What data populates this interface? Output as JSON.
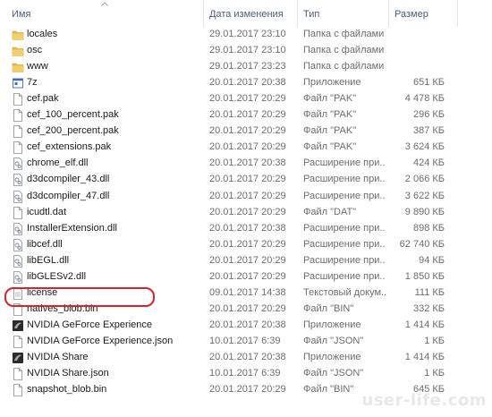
{
  "columns": {
    "name": "Имя",
    "date": "Дата изменения",
    "type": "Тип",
    "size": "Размер"
  },
  "files": [
    {
      "name": "locales",
      "date": "29.01.2017 23:10",
      "type": "Папка с файлами",
      "size": "",
      "icon": "folder-icon"
    },
    {
      "name": "osc",
      "date": "29.01.2017 23:10",
      "type": "Папка с файлами",
      "size": "",
      "icon": "folder-icon"
    },
    {
      "name": "www",
      "date": "29.01.2017 23:23",
      "type": "Папка с файлами",
      "size": "",
      "icon": "folder-icon"
    },
    {
      "name": "7z",
      "date": "20.01.2017 20:38",
      "type": "Приложение",
      "size": "651 КБ",
      "icon": "app-icon"
    },
    {
      "name": "cef.pak",
      "date": "20.01.2017 20:29",
      "type": "Файл \"PAK\"",
      "size": "4 478 КБ",
      "icon": "file-icon"
    },
    {
      "name": "cef_100_percent.pak",
      "date": "20.01.2017 20:29",
      "type": "Файл \"PAK\"",
      "size": "296 КБ",
      "icon": "file-icon"
    },
    {
      "name": "cef_200_percent.pak",
      "date": "20.01.2017 20:29",
      "type": "Файл \"PAK\"",
      "size": "387 КБ",
      "icon": "file-icon"
    },
    {
      "name": "cef_extensions.pak",
      "date": "20.01.2017 20:29",
      "type": "Файл \"PAK\"",
      "size": "3 624 КБ",
      "icon": "file-icon"
    },
    {
      "name": "chrome_elf.dll",
      "date": "20.01.2017 20:38",
      "type": "Расширение при...",
      "size": "424 КБ",
      "icon": "dll-icon"
    },
    {
      "name": "d3dcompiler_43.dll",
      "date": "20.01.2017 20:29",
      "type": "Расширение при...",
      "size": "2 066 КБ",
      "icon": "dll-icon"
    },
    {
      "name": "d3dcompiler_47.dll",
      "date": "20.01.2017 20:29",
      "type": "Расширение при...",
      "size": "3 622 КБ",
      "icon": "dll-icon"
    },
    {
      "name": "icudtl.dat",
      "date": "20.01.2017 20:29",
      "type": "Файл \"DAT\"",
      "size": "9 890 КБ",
      "icon": "file-icon"
    },
    {
      "name": "InstallerExtension.dll",
      "date": "20.01.2017 20:38",
      "type": "Расширение при...",
      "size": "898 КБ",
      "icon": "dll-icon"
    },
    {
      "name": "libcef.dll",
      "date": "20.01.2017 20:29",
      "type": "Расширение при...",
      "size": "62 740 КБ",
      "icon": "dll-icon"
    },
    {
      "name": "libEGL.dll",
      "date": "20.01.2017 20:29",
      "type": "Расширение при...",
      "size": "94 КБ",
      "icon": "dll-icon"
    },
    {
      "name": "libGLESv2.dll",
      "date": "20.01.2017 20:29",
      "type": "Расширение при...",
      "size": "1 850 КБ",
      "icon": "dll-icon"
    },
    {
      "name": "license",
      "date": "09.01.2017 14:38",
      "type": "Текстовый докум...",
      "size": "111 КБ",
      "icon": "text-file-icon"
    },
    {
      "name": "natives_blob.bin",
      "date": "20.01.2017 20:29",
      "type": "Файл \"BIN\"",
      "size": "332 КБ",
      "icon": "file-icon"
    },
    {
      "name": "NVIDIA GeForce Experience",
      "date": "20.01.2017 20:38",
      "type": "Приложение",
      "size": "1 414 КБ",
      "icon": "nvidia-icon"
    },
    {
      "name": "NVIDIA GeForce Experience.json",
      "date": "10.01.2017 6:39",
      "type": "Файл \"JSON\"",
      "size": "1 КБ",
      "icon": "file-icon"
    },
    {
      "name": "NVIDIA Share",
      "date": "20.01.2017 20:38",
      "type": "Приложение",
      "size": "1 414 КБ",
      "icon": "nvidia-icon"
    },
    {
      "name": "NVIDIA Share.json",
      "date": "10.01.2017 6:39",
      "type": "Файл \"JSON\"",
      "size": "1 КБ",
      "icon": "file-icon"
    },
    {
      "name": "snapshot_blob.bin",
      "date": "20.01.2017 20:29",
      "type": "Файл \"BIN\"",
      "size": "645 КБ",
      "icon": "file-icon"
    }
  ],
  "highlighted_file": "NVIDIA GeForce Experience",
  "watermark": "user-life.com",
  "colors": {
    "header_text": "#4c607a",
    "highlight_outline": "#d9232e",
    "folder": "#e8bc50"
  }
}
